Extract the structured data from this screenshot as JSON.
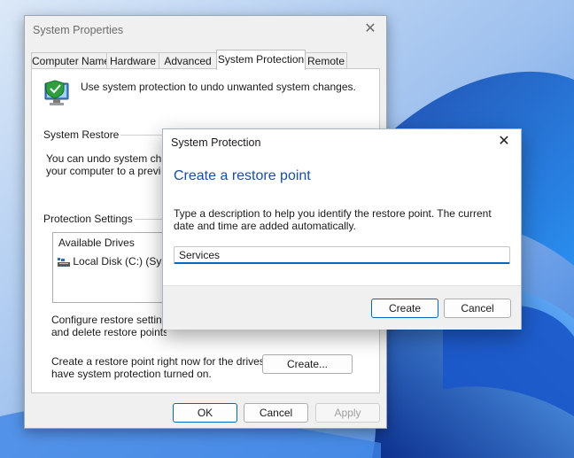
{
  "colors": {
    "accent": "#0067c0",
    "heading_blue": "#1b4ea0",
    "desktop_blue": "#2a6fd6"
  },
  "system_properties": {
    "title": "System Properties",
    "close_icon": "close-icon",
    "tabs": [
      {
        "label": "Computer Name",
        "active": false
      },
      {
        "label": "Hardware",
        "active": false
      },
      {
        "label": "Advanced",
        "active": false
      },
      {
        "label": "System Protection",
        "active": true
      },
      {
        "label": "Remote",
        "active": false
      }
    ],
    "intro_text": "Use system protection to undo unwanted system changes.",
    "system_restore": {
      "heading": "System Restore",
      "text_line1": "You can undo system chang",
      "text_line2": "your computer to a previous"
    },
    "protection_settings": {
      "heading": "Protection Settings",
      "column_header": "Available Drives",
      "drives": [
        {
          "name": "Local Disk (C:) (System",
          "icon": "drive-icon"
        }
      ]
    },
    "configure": {
      "text_line1": "Configure restore settings, m",
      "text_line2": "and delete restore points."
    },
    "create": {
      "text_line1": "Create a restore point right now for the drives that",
      "text_line2": "have system protection turned on.",
      "button_label": "Create..."
    },
    "footer": {
      "ok_label": "OK",
      "cancel_label": "Cancel",
      "apply_label": "Apply"
    }
  },
  "dialog": {
    "title": "System Protection",
    "heading": "Create a restore point",
    "description": "Type a description to help you identify the restore point. The current date and time are added automatically.",
    "input_value": "Services",
    "create_label": "Create",
    "cancel_label": "Cancel"
  }
}
